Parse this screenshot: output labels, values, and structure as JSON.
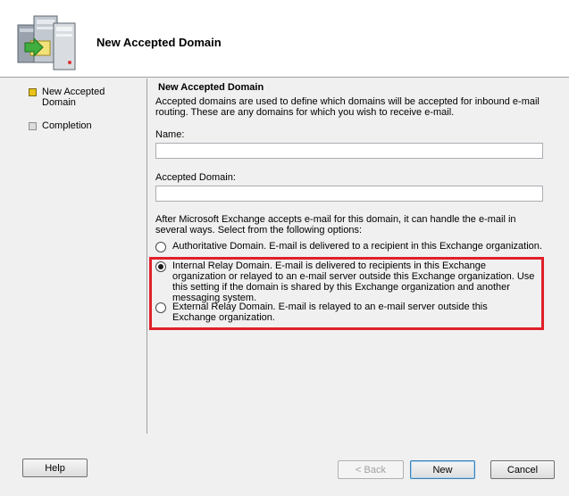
{
  "header": {
    "title": "New Accepted Domain"
  },
  "nav": {
    "items": [
      {
        "label": "New Accepted Domain",
        "state": "active",
        "icon": "yellow-square-icon"
      },
      {
        "label": "Completion",
        "state": "inactive",
        "icon": "gray-square-icon"
      }
    ]
  },
  "main": {
    "title": "New Accepted Domain",
    "description": "Accepted domains are used to define which domains will be accepted for inbound e-mail routing.  These are any domains for which you wish to receive e-mail.",
    "name_label": "Name:",
    "name_value": "",
    "accepted_domain_label": "Accepted Domain:",
    "accepted_domain_value": "",
    "options_intro": "After Microsoft Exchange accepts e-mail for this domain, it can handle the e-mail in several ways. Select from the following options:",
    "options": [
      {
        "label": "Authoritative Domain. E-mail is delivered to a recipient in this Exchange organization.",
        "selected": false
      },
      {
        "label": "Internal Relay Domain. E-mail is delivered to recipients in this Exchange organization or relayed to an e-mail server outside this Exchange organization. Use this setting if the domain is shared by this Exchange organization and another messaging system.",
        "selected": true
      },
      {
        "label": "External Relay Domain. E-mail is relayed to an e-mail server outside this Exchange organization.",
        "selected": false
      }
    ]
  },
  "buttons": {
    "help": "Help",
    "back": "< Back",
    "new": "New",
    "cancel": "Cancel"
  },
  "colors": {
    "highlight": "#e0202a",
    "active_nav": "#e8c21a"
  }
}
